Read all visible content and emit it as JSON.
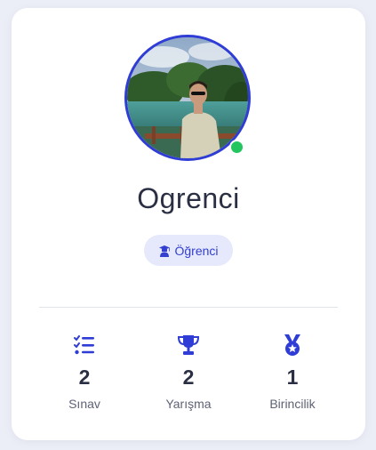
{
  "profile": {
    "name": "Ogrenci",
    "role": "Öğrenci",
    "online": true,
    "avatar_icon": "profile-photo"
  },
  "stats": [
    {
      "value": "2",
      "label": "Sınav",
      "icon": "checklist-icon"
    },
    {
      "value": "2",
      "label": "Yarışma",
      "icon": "trophy-icon"
    },
    {
      "value": "1",
      "label": "Birincilik",
      "icon": "medal-icon"
    }
  ],
  "colors": {
    "accent": "#2f3dd6",
    "online": "#22c55e",
    "badge_bg": "#e6e8fb",
    "text": "#2b2f44"
  }
}
